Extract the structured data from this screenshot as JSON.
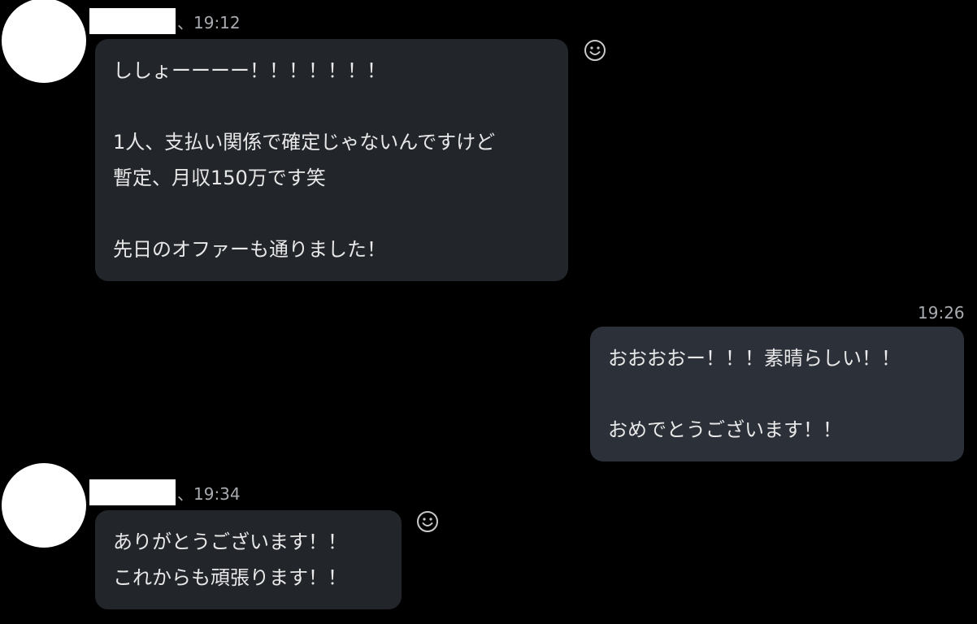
{
  "colors": {
    "background": "#000000",
    "incoming_bubble": "#22252a",
    "outgoing_bubble": "#2c3038",
    "text": "#e8e8e8",
    "meta": "#a8abb0"
  },
  "messages": [
    {
      "direction": "incoming",
      "sender_redacted": true,
      "meta": "、19:12",
      "lines": [
        "ししょーーーー！！！！！！！",
        "",
        "1人、支払い関係で確定じゃないんですけど",
        "暫定、月収150万です笑",
        "",
        "先日のオファーも通りました！"
      ],
      "reaction_icon": "smiley-icon"
    },
    {
      "direction": "outgoing",
      "meta": "19:26",
      "lines": [
        "おおおおー！！！素晴らしい！！",
        "",
        "おめでとうございます！！"
      ]
    },
    {
      "direction": "incoming",
      "sender_redacted": true,
      "meta": "、19:34",
      "lines": [
        "ありがとうございます！！",
        "これからも頑張ります！！"
      ],
      "reaction_icon": "smiley-icon"
    }
  ]
}
